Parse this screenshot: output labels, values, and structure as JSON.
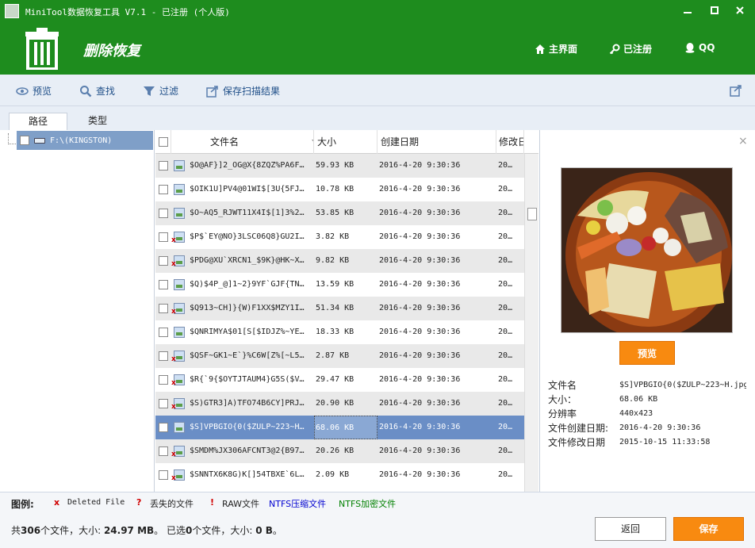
{
  "window": {
    "title": "MiniTool数据恢复工具 V7.1 - 已注册 (个人版)",
    "minimize": "▬",
    "maximize": "■",
    "close": "✕"
  },
  "header": {
    "mode_title": "删除恢复",
    "nav": {
      "home": "主界面",
      "registered": "已注册",
      "qq": "QQ"
    }
  },
  "toolbar": {
    "preview": "预览",
    "find": "查找",
    "filter": "过滤",
    "save_scan": "保存扫描结果"
  },
  "tabs": {
    "path": "路径",
    "type": "类型"
  },
  "tree": {
    "drive_label": "F:\\(KINGSTON)"
  },
  "file_list": {
    "columns": {
      "name": "文件名",
      "size": "大小",
      "created": "创建日期",
      "modified": "修改日"
    },
    "rows": [
      {
        "name": "$O@AF}]2_OG@X{8ZQZ%PA6F…",
        "size": "59.93 KB",
        "created": "2016-4-20 9:30:36",
        "modified": "20…",
        "deleted": false
      },
      {
        "name": "$OIK1U]PV4@01WI$[3U{5FJ…",
        "size": "10.78 KB",
        "created": "2016-4-20 9:30:36",
        "modified": "20…",
        "deleted": false
      },
      {
        "name": "$O~AQ5_RJWT11X4I$[1]3%2…",
        "size": "53.85 KB",
        "created": "2016-4-20 9:30:36",
        "modified": "20…",
        "deleted": false
      },
      {
        "name": "$P$`EY@NO}3LSC06Q8}GU2I…",
        "size": "3.82 KB",
        "created": "2016-4-20 9:30:36",
        "modified": "20…",
        "deleted": true
      },
      {
        "name": "$PDG@XU`XRCN1_$9K}@HK~X…",
        "size": "9.82 KB",
        "created": "2016-4-20 9:30:36",
        "modified": "20…",
        "deleted": true
      },
      {
        "name": "$Q)$4P_@]1~2}9YF`GJF{TN…",
        "size": "13.59 KB",
        "created": "2016-4-20 9:30:36",
        "modified": "20…",
        "deleted": false
      },
      {
        "name": "$Q913~CH]}{W)F1XX$MZY1I…",
        "size": "51.34 KB",
        "created": "2016-4-20 9:30:36",
        "modified": "20…",
        "deleted": true
      },
      {
        "name": "$QNRIMYA$01[S[$IDJZ%~YE…",
        "size": "18.33 KB",
        "created": "2016-4-20 9:30:36",
        "modified": "20…",
        "deleted": false
      },
      {
        "name": "$QSF~GK1~E`}%C6W[Z%[~L5…",
        "size": "2.87 KB",
        "created": "2016-4-20 9:30:36",
        "modified": "20…",
        "deleted": true
      },
      {
        "name": "$R{`9{$OYTJTAUM4}G5S($V…",
        "size": "29.47 KB",
        "created": "2016-4-20 9:30:36",
        "modified": "20…",
        "deleted": true
      },
      {
        "name": "$S)GTR3]A)TFO74B6CY]PRJ…",
        "size": "20.90 KB",
        "created": "2016-4-20 9:30:36",
        "modified": "20…",
        "deleted": true
      },
      {
        "name": "$S]VPBGIO{0($ZULP~223~H…",
        "size": "68.06 KB",
        "created": "2016-4-20 9:30:36",
        "modified": "20…",
        "deleted": false,
        "selected": true
      },
      {
        "name": "$SMDM%JX306AFCNT3@2{B97…",
        "size": "20.26 KB",
        "created": "2016-4-20 9:30:36",
        "modified": "20…",
        "deleted": true
      },
      {
        "name": "$SNNTX6K8G)K[]54TBXE`6L…",
        "size": "2.09 KB",
        "created": "2016-4-20 9:30:36",
        "modified": "20…",
        "deleted": true
      }
    ]
  },
  "preview": {
    "button": "预览",
    "info": [
      {
        "key": "文件名",
        "value": "$S]VPBGIO{0($ZULP~223~H.jpg"
      },
      {
        "key": "大小：",
        "value": "68.06 KB"
      },
      {
        "key": "分辨率",
        "value": "440x423"
      },
      {
        "key": "文件创建日期:",
        "value": "2016-4-20 9:30:36"
      },
      {
        "key": "文件修改日期",
        "value": "2015-10-15 11:33:58"
      }
    ]
  },
  "legend": {
    "title": "图例:",
    "deleted_mark": "x",
    "deleted": "Deleted File",
    "lost_mark": "?",
    "lost": "丢失的文件",
    "raw_mark": "!",
    "raw": "RAW文件",
    "ntfs_compressed": "NTFS压缩文件",
    "ntfs_encrypted": "NTFS加密文件"
  },
  "footer": {
    "status_prefix": "共",
    "file_count": "306",
    "status_mid1": "个文件，大小: ",
    "total_size": "24.97 MB",
    "status_mid2": "。 已选",
    "selected_count": "0",
    "status_mid3": "个文件，大小: ",
    "selected_size": "0 B",
    "status_suffix": "。",
    "back": "返回",
    "save": "保存"
  },
  "colors": {
    "header_green": "#1e8c1e",
    "accent_orange": "#f88a10",
    "selection_blue": "#6a8ec6"
  }
}
